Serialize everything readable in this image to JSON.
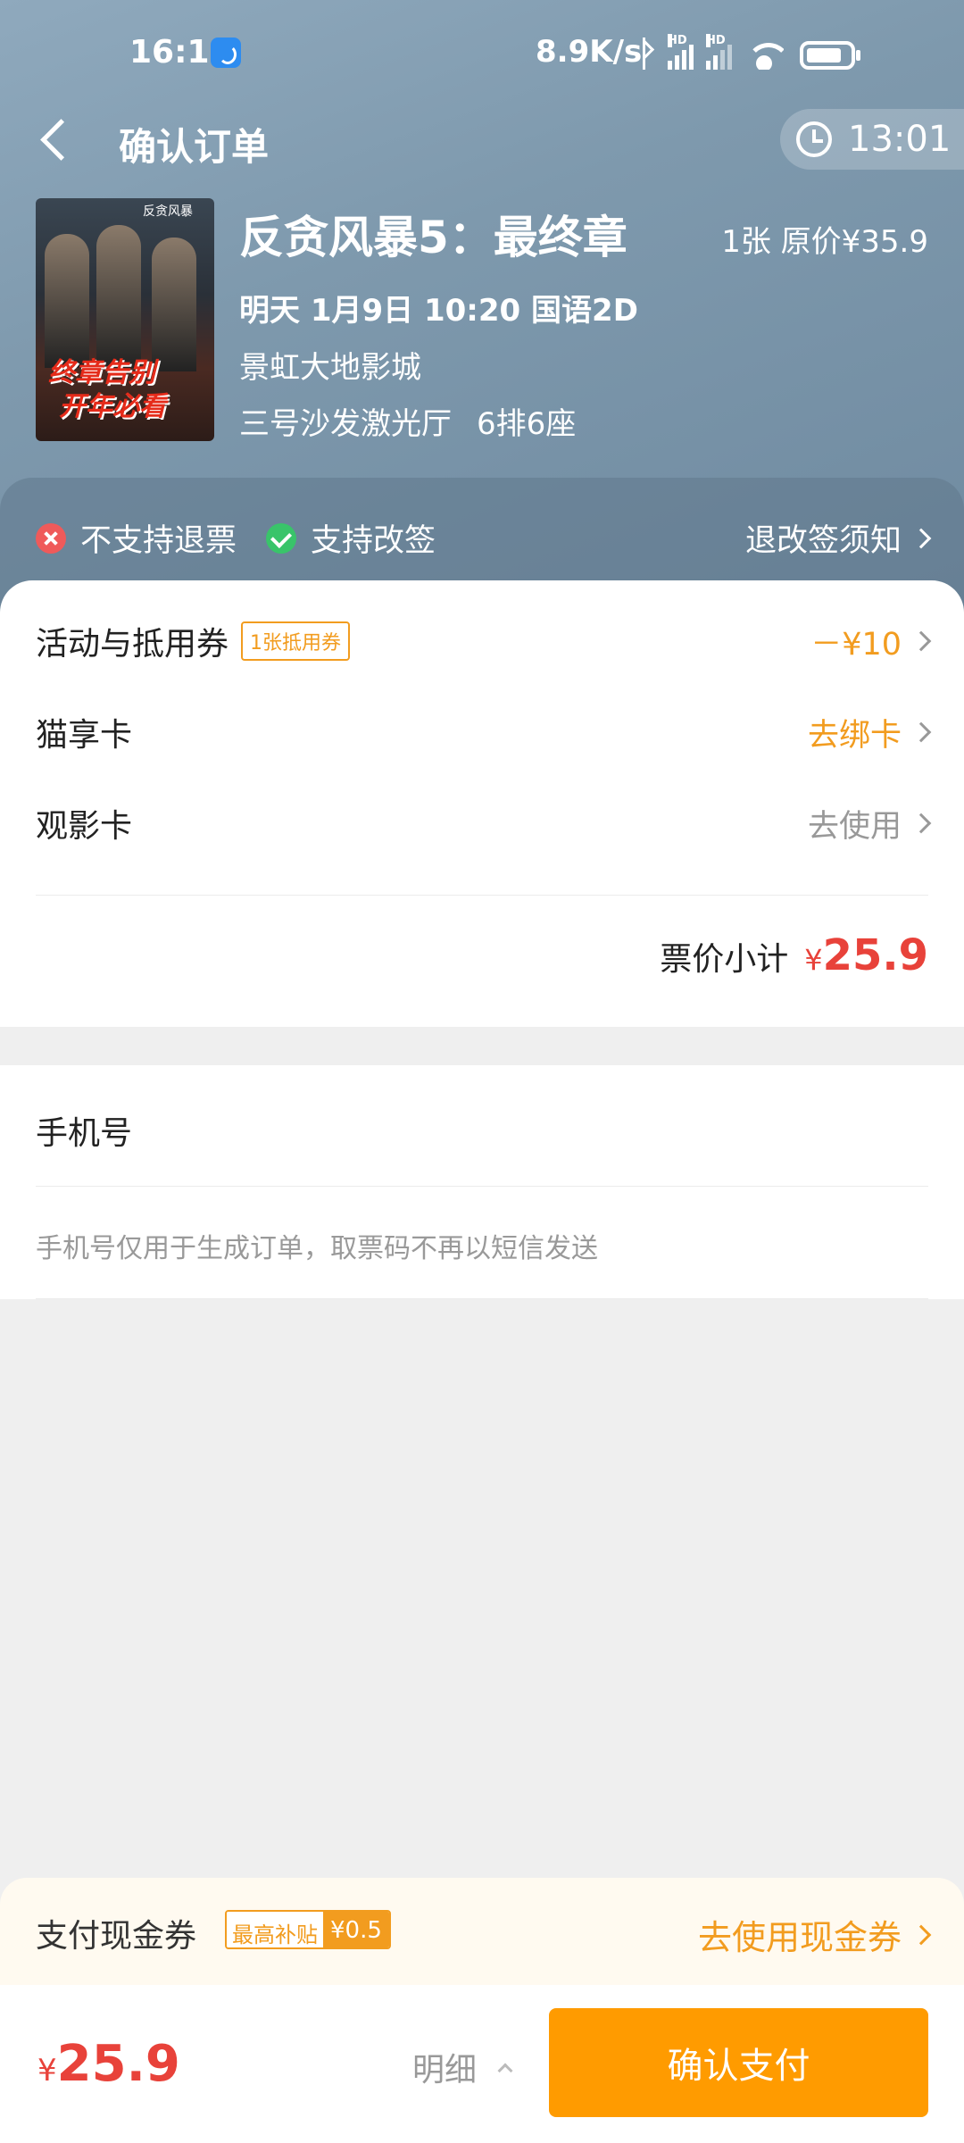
{
  "status_bar": {
    "time": "16:10",
    "net_speed": "8.9K/s",
    "signal_label": "HD"
  },
  "nav": {
    "title": "确认订单",
    "countdown": "13:01"
  },
  "movie": {
    "title": "反贪风暴5：最终章",
    "price_info": "1张 原价¥35.9",
    "showtime": "明天 1月9日 10:20 国语2D",
    "cinema": "景虹大地影城",
    "hall": "三号沙发激光厅",
    "seat": "6排6座",
    "poster": {
      "top_text": "反贪风暴",
      "line1": "终章告别",
      "line2": "开年必看"
    }
  },
  "policy": {
    "refund": "不支持退票",
    "change": "支持改签",
    "notice_link": "退改签须知"
  },
  "discounts": {
    "activity_label": "活动与抵用券",
    "activity_badge": "1张抵用券",
    "activity_value": "－¥10",
    "cat_card_label": "猫享卡",
    "cat_card_value": "去绑卡",
    "movie_card_label": "观影卡",
    "movie_card_value": "去使用"
  },
  "subtotal": {
    "label": "票价小计",
    "currency": "¥",
    "amount": "25.9"
  },
  "phone": {
    "label": "手机号",
    "note": "手机号仅用于生成订单，取票码不再以短信发送"
  },
  "coupon_strip": {
    "label": "支付现金券",
    "tag_label": "最高补贴",
    "tag_value": "¥0.5",
    "link": "去使用现金券"
  },
  "bottom": {
    "currency": "¥",
    "total": "25.9",
    "detail": "明细",
    "pay_button": "确认支付"
  },
  "colors": {
    "accent_orange": "#ff9b00",
    "price_red": "#e8423a",
    "header_blue": "#7e99ad"
  }
}
